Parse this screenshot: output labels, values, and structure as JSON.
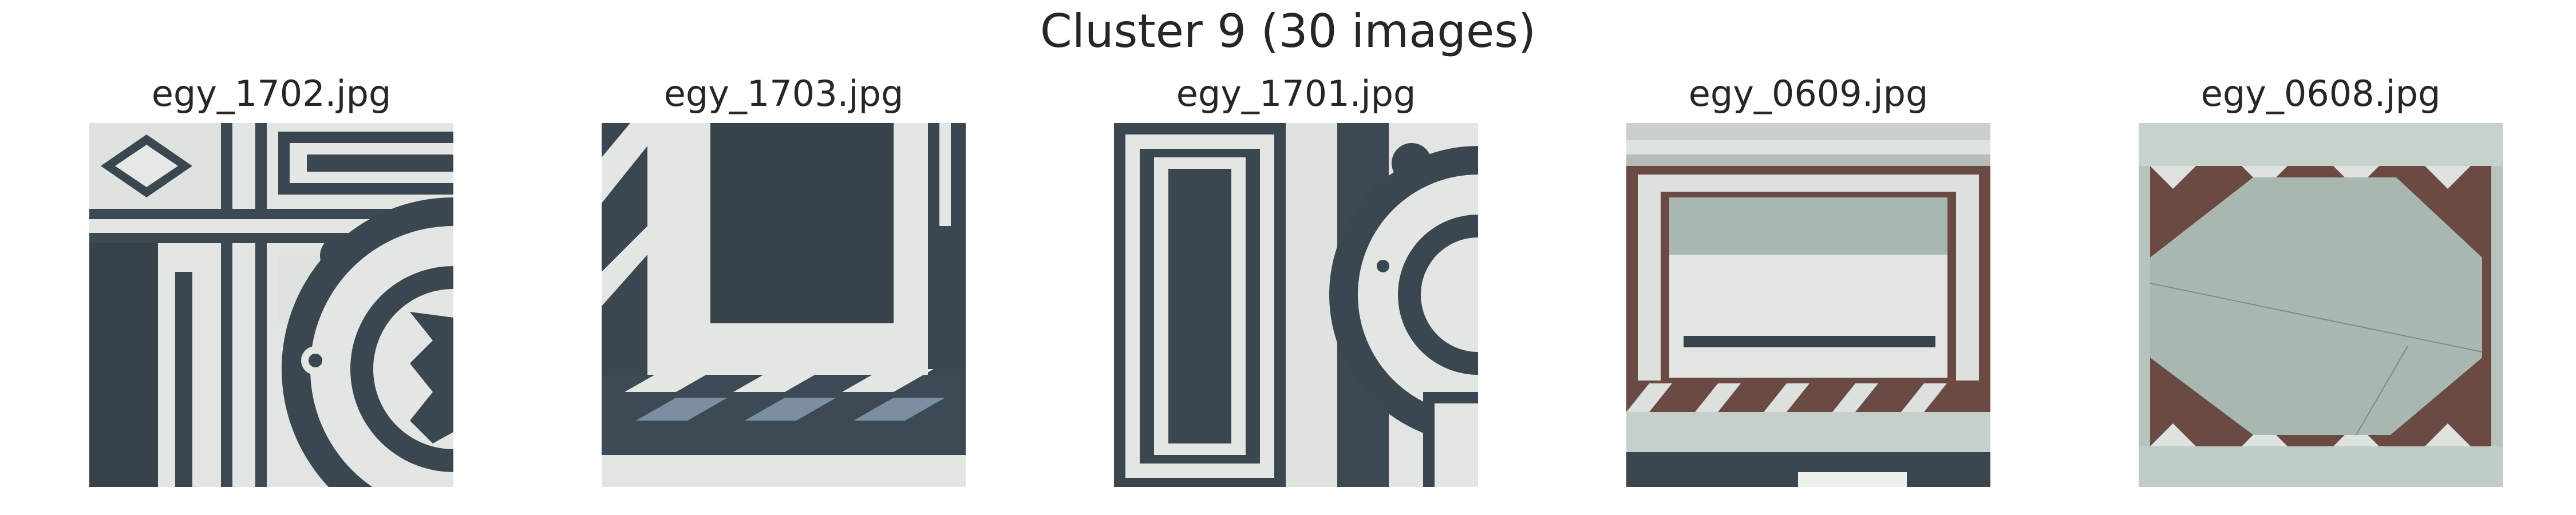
{
  "figure": {
    "title": "Cluster 9 (30 images)"
  },
  "images": [
    {
      "filename": "egy_1702.jpg"
    },
    {
      "filename": "egy_1703.jpg"
    },
    {
      "filename": "egy_1701.jpg"
    },
    {
      "filename": "egy_0609.jpg"
    },
    {
      "filename": "egy_0608.jpg"
    }
  ],
  "colors": {
    "marble_white": "#e4e6e3",
    "marble_dark": "#38434c",
    "marble_green": "#a8b7af",
    "marble_red": "#6a4a43",
    "text": "#262626"
  }
}
